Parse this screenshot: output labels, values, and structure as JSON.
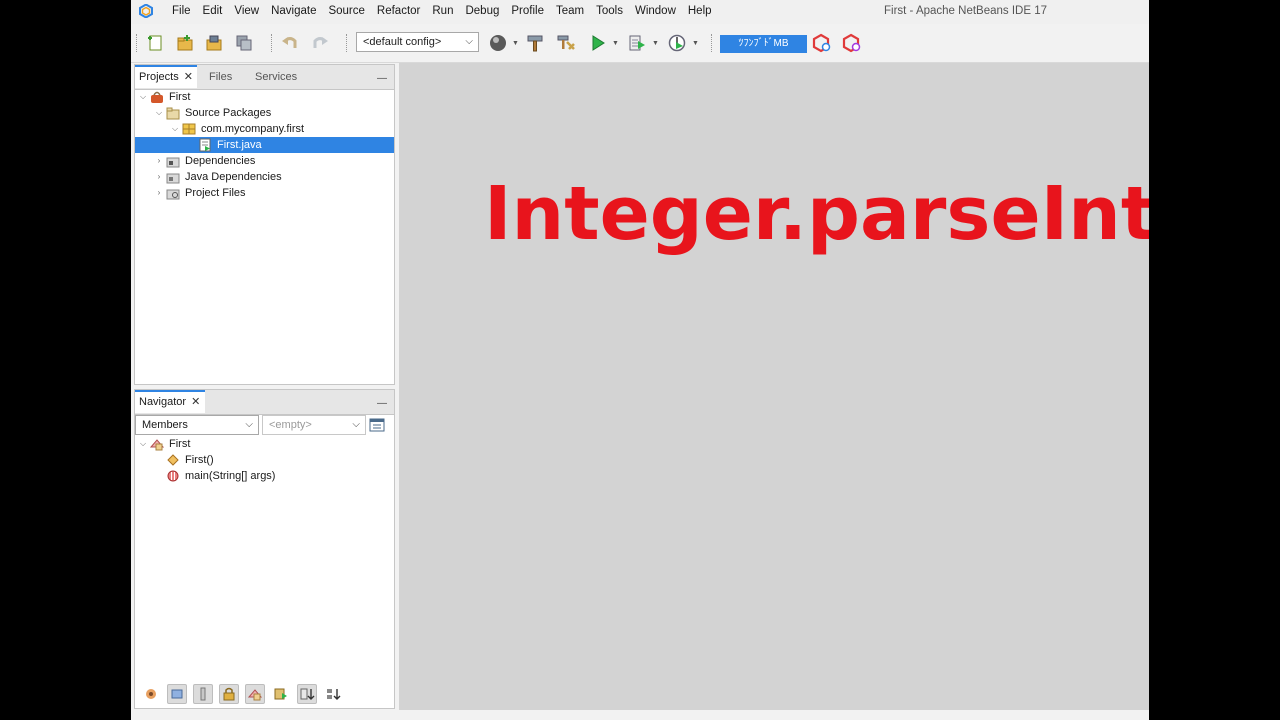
{
  "window": {
    "title": "First - Apache NetBeans IDE 17"
  },
  "menu": [
    "File",
    "Edit",
    "View",
    "Navigate",
    "Source",
    "Refactor",
    "Run",
    "Debug",
    "Profile",
    "Team",
    "Tools",
    "Window",
    "Help"
  ],
  "toolbar": {
    "config_value": "<default config>",
    "memory_text": "ﾂﾌﾝﾌﾞﾄﾞMB"
  },
  "projects_panel": {
    "tabs": [
      {
        "label": "Projects",
        "active": true
      },
      {
        "label": "Files",
        "active": false
      },
      {
        "label": "Services",
        "active": false
      }
    ],
    "close_glyph": "✕",
    "minimize_glyph": "—",
    "tree": [
      {
        "label": "First",
        "depth": 0,
        "icon": "project-icon",
        "expanded": true
      },
      {
        "label": "Source Packages",
        "depth": 1,
        "icon": "source-packages-icon",
        "expanded": true
      },
      {
        "label": "com.mycompany.first",
        "depth": 2,
        "icon": "package-icon",
        "expanded": true
      },
      {
        "label": "First.java",
        "depth": 3,
        "icon": "java-file-icon",
        "selected": true
      },
      {
        "label": "Dependencies",
        "depth": 1,
        "icon": "dependencies-icon",
        "expanded": false
      },
      {
        "label": "Java Dependencies",
        "depth": 1,
        "icon": "java-dependencies-icon",
        "expanded": false
      },
      {
        "label": "Project Files",
        "depth": 1,
        "icon": "project-files-icon",
        "expanded": false
      }
    ]
  },
  "navigator_panel": {
    "tab": "Navigator",
    "close_glyph": "✕",
    "minimize_glyph": "—",
    "members_select": "Members",
    "filter_select": "<empty>",
    "tree": [
      {
        "label": "First",
        "depth": 0,
        "icon": "class-icon",
        "expanded": true
      },
      {
        "label": "First()",
        "depth": 1,
        "icon": "constructor-icon"
      },
      {
        "label": "main(String[] args)",
        "depth": 1,
        "icon": "method-icon"
      }
    ]
  },
  "overlay": {
    "text": "Integer.parseInt"
  },
  "colors": {
    "selection": "#2f84e3",
    "overlay_text": "#e8141c",
    "editor_background": "#d3d3d3"
  }
}
